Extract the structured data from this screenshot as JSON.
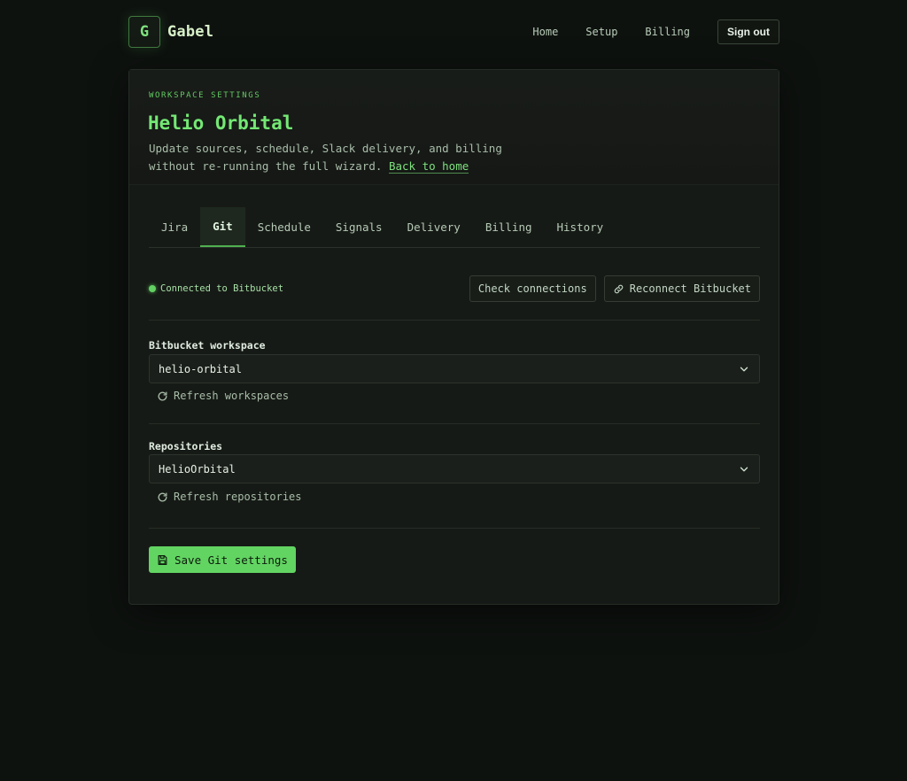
{
  "brand": {
    "logo_letter": "G",
    "name": "Gabel"
  },
  "nav": {
    "home": "Home",
    "setup": "Setup",
    "billing": "Billing",
    "sign_out": "Sign out"
  },
  "header": {
    "eyebrow": "WORKSPACE SETTINGS",
    "title": "Helio Orbital",
    "subtitle": "Update sources, schedule, Slack delivery, and billing without re-running the full wizard.",
    "back_link": "Back to home"
  },
  "tabs": [
    {
      "label": "Jira"
    },
    {
      "label": "Git",
      "active": true
    },
    {
      "label": "Schedule"
    },
    {
      "label": "Signals"
    },
    {
      "label": "Delivery"
    },
    {
      "label": "Billing"
    },
    {
      "label": "History"
    }
  ],
  "status": {
    "text": "Connected to Bitbucket",
    "check_button": "Check connections",
    "reconnect_button": "Reconnect Bitbucket"
  },
  "workspace": {
    "label": "Bitbucket workspace",
    "value": "helio-orbital",
    "refresh": "Refresh workspaces"
  },
  "repositories": {
    "label": "Repositories",
    "value": "HelioOrbital",
    "refresh": "Refresh repositories"
  },
  "save_button": "Save Git settings",
  "colors": {
    "accent": "#62d462",
    "background": "#0e120f",
    "card": "#161a16"
  }
}
